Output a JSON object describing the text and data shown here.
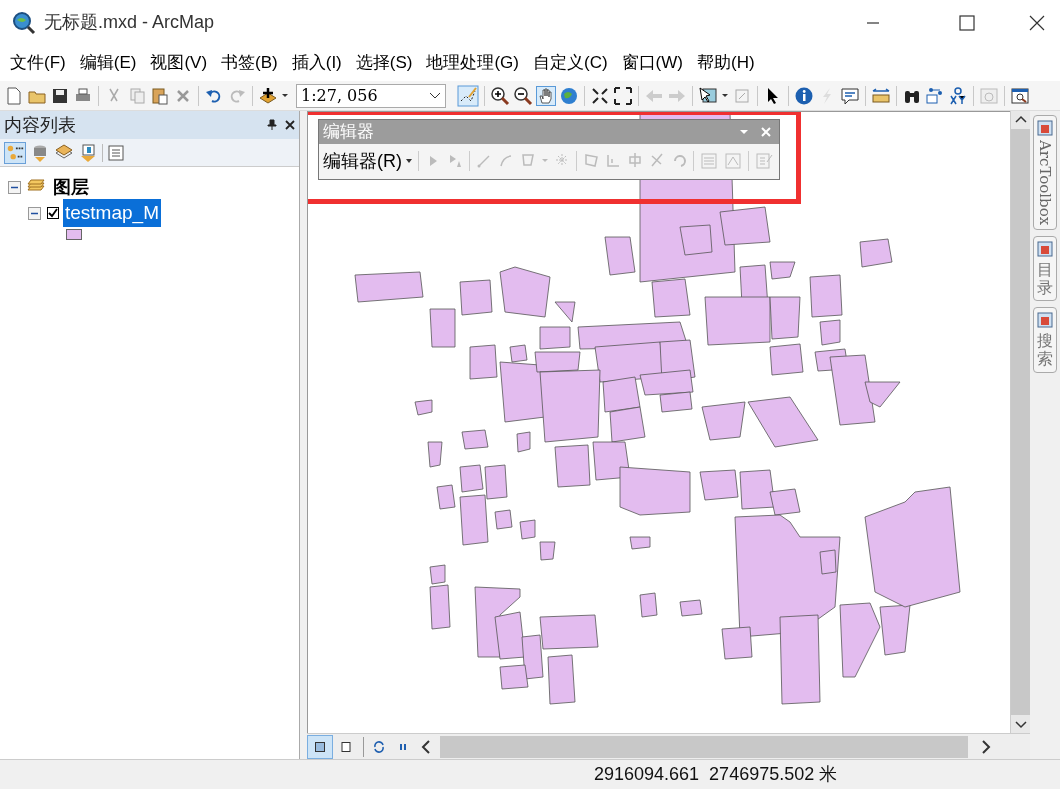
{
  "window": {
    "title": "无标题.mxd - ArcMap"
  },
  "menu": [
    "文件(F)",
    "编辑(E)",
    "视图(V)",
    "书签(B)",
    "插入(I)",
    "选择(S)",
    "地理处理(G)",
    "自定义(C)",
    "窗口(W)",
    "帮助(H)"
  ],
  "toolbar": {
    "scale": "1:27, 056"
  },
  "toc": {
    "title": "内容列表",
    "tree": [
      {
        "label": "图层",
        "expanded": true,
        "children": [
          {
            "label": "testmap_M",
            "checked": true,
            "selected": true,
            "expanded": true
          }
        ]
      }
    ]
  },
  "editor_toolbar": {
    "title": "编辑器",
    "menu": "编辑器(R)"
  },
  "dock_tabs": [
    {
      "label": "ArcToolbox",
      "kind": "latin"
    },
    {
      "label": "目录",
      "kind": "cjk"
    },
    {
      "label": "搜索",
      "kind": "cjk"
    }
  ],
  "status_bar": {
    "coordinates": "2916094.661  2746975.502 米"
  }
}
